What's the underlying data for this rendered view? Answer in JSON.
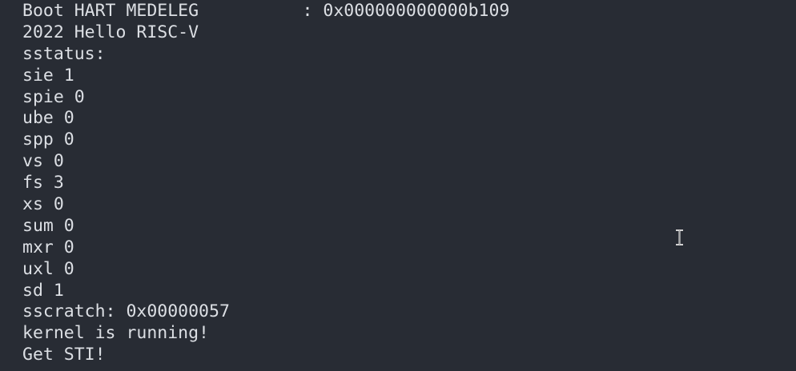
{
  "terminal": {
    "lines": [
      "Boot HART MEDELEG          : 0x000000000000b109",
      "2022 Hello RISC-V",
      "sstatus:",
      "sie 1",
      "spie 0",
      "ube 0",
      "spp 0",
      "vs 0",
      "fs 3",
      "xs 0",
      "sum 0",
      "mxr 0",
      "uxl 0",
      "sd 1",
      "sscratch: 0x00000057",
      "kernel is running!",
      "Get STI!"
    ],
    "colors": {
      "background": "#282c34",
      "foreground": "#dcdfe4"
    },
    "pointer_icon": "text-ibeam-cursor-icon"
  }
}
